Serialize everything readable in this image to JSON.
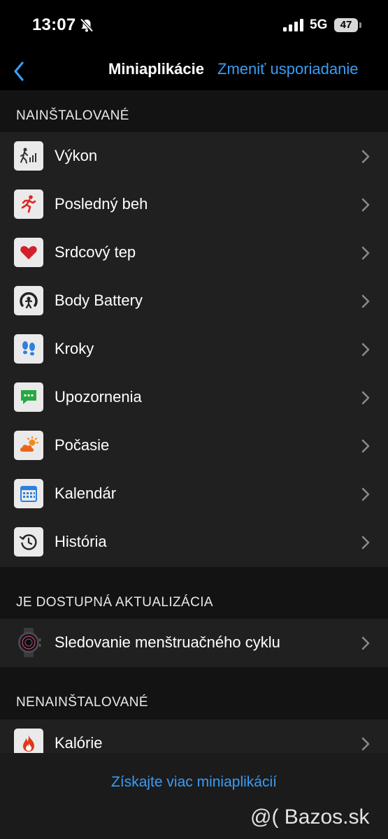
{
  "status_bar": {
    "time": "13:07",
    "network": "5G",
    "battery": "47"
  },
  "nav": {
    "title": "Miniaplikácie",
    "action": "Zmeniť usporiadanie"
  },
  "sections": {
    "installed": {
      "header": "NAINŠTALOVANÉ",
      "items": [
        {
          "label": "Výkon",
          "icon": "performance-icon"
        },
        {
          "label": "Posledný beh",
          "icon": "running-icon"
        },
        {
          "label": "Srdcový tep",
          "icon": "heart-icon"
        },
        {
          "label": "Body Battery",
          "icon": "body-battery-icon"
        },
        {
          "label": "Kroky",
          "icon": "footsteps-icon"
        },
        {
          "label": "Upozornenia",
          "icon": "message-icon"
        },
        {
          "label": "Počasie",
          "icon": "weather-icon"
        },
        {
          "label": "Kalendár",
          "icon": "calendar-icon"
        },
        {
          "label": "História",
          "icon": "history-icon"
        }
      ]
    },
    "update": {
      "header": "JE DOSTUPNÁ AKTUALIZÁCIA",
      "items": [
        {
          "label": "Sledovanie menštruačného cyklu",
          "icon": "watch-icon"
        }
      ]
    },
    "not_installed": {
      "header": "NENAINŠTALOVANÉ",
      "items": [
        {
          "label": "Kalórie",
          "icon": "flame-icon"
        }
      ]
    }
  },
  "footer": {
    "more_link": "Získajte viac miniaplikácií"
  },
  "watermark": "@( Bazos.sk",
  "colors": {
    "accent": "#3b9cf4",
    "background": "#131313",
    "row_background": "#202020"
  }
}
